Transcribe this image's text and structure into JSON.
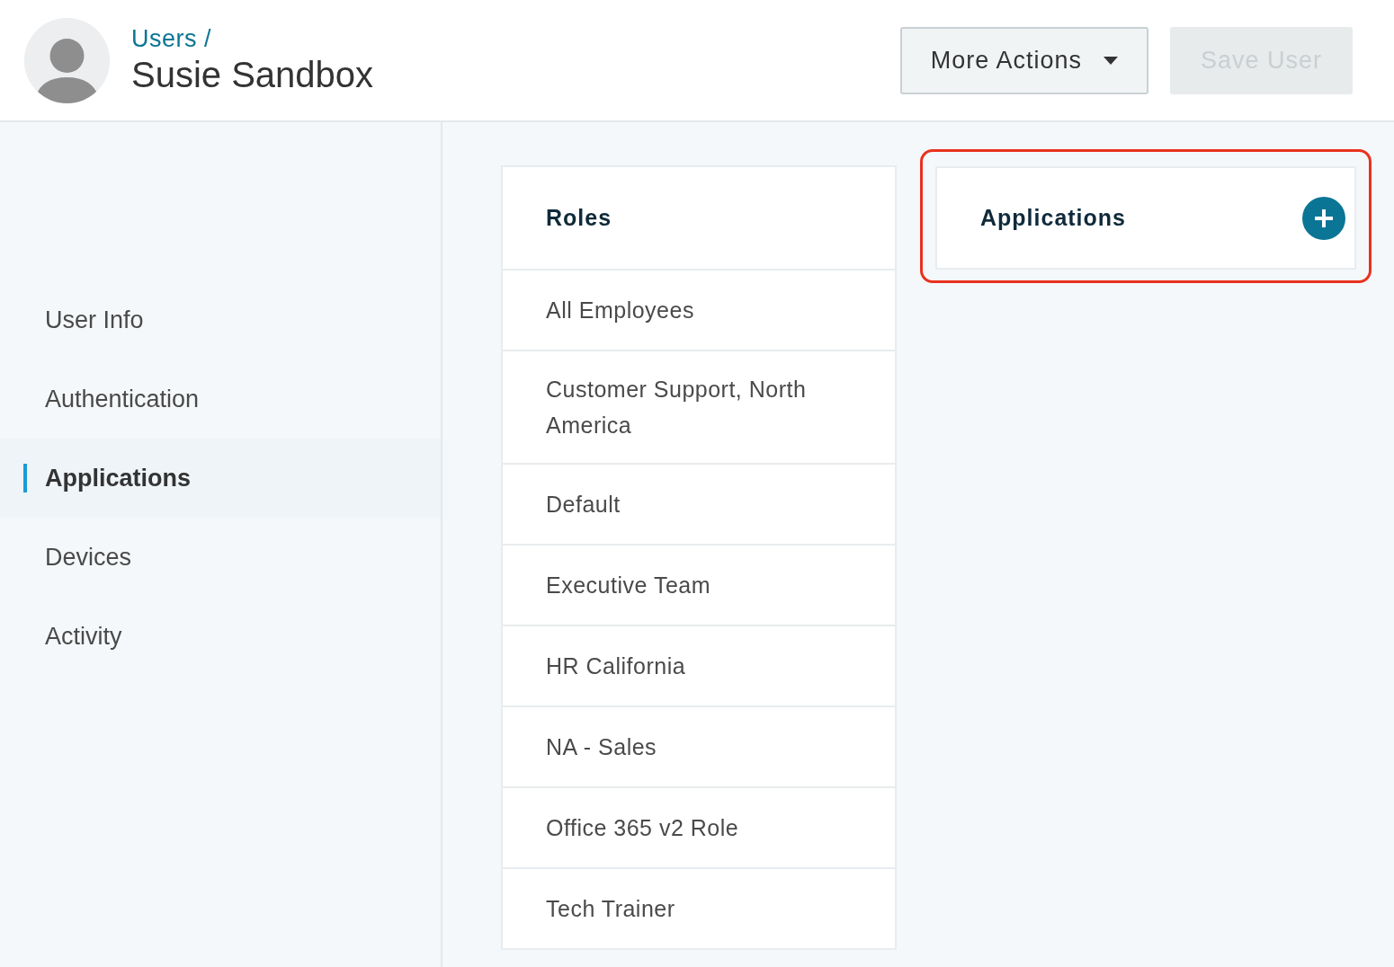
{
  "header": {
    "breadcrumb": "Users /",
    "title": "Susie Sandbox",
    "buttons": [
      {
        "label": "More Actions",
        "kind": "dropdown",
        "disabled": false
      },
      {
        "label": "Save User",
        "kind": "primary",
        "disabled": true
      }
    ]
  },
  "sidebar": {
    "items": [
      {
        "label": "User Info",
        "selected": false
      },
      {
        "label": "Authentication",
        "selected": false
      },
      {
        "label": "Applications",
        "selected": true
      },
      {
        "label": "Devices",
        "selected": false
      },
      {
        "label": "Activity",
        "selected": false
      }
    ]
  },
  "roles_panel": {
    "title": "Roles",
    "items": [
      "All Employees",
      "Customer Support, North America",
      "Default",
      "Executive Team",
      "HR California",
      "NA - Sales",
      "Office 365 v2 Role",
      "Tech Trainer"
    ]
  },
  "applications_panel": {
    "title": "Applications",
    "highlighted": true
  }
}
